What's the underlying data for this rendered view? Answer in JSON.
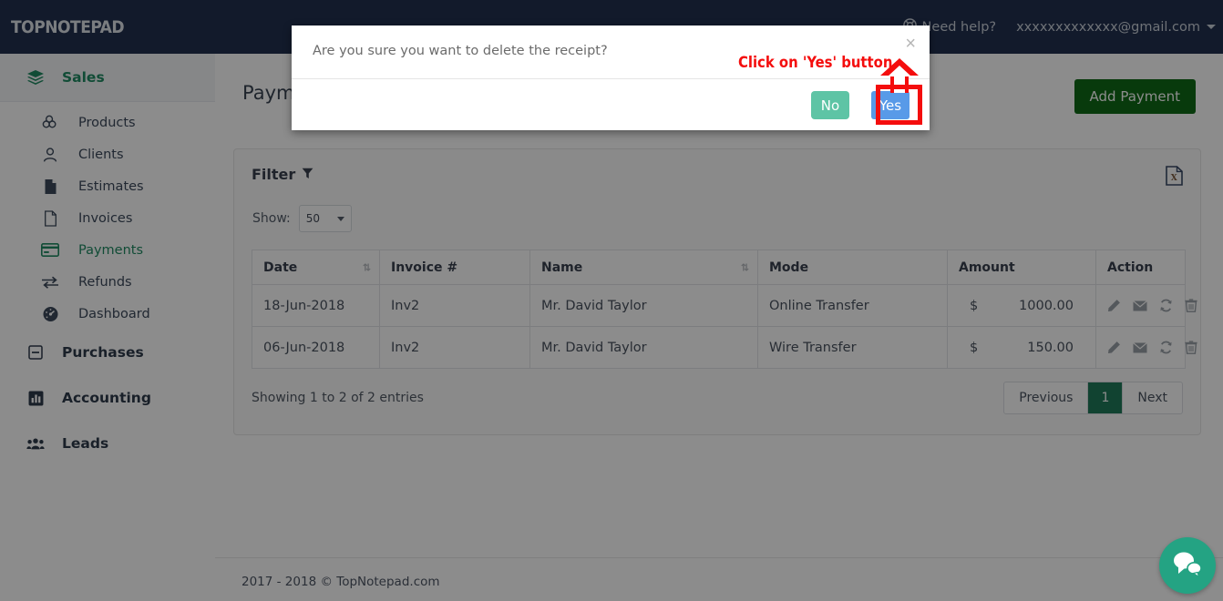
{
  "header": {
    "logo": "TopNotepad",
    "need_help": "Need help?",
    "user_email": "xxxxxxxxxxxxx@gmail.com",
    "bg_color": "#22304f"
  },
  "sidebar": {
    "sections": [
      {
        "label": "Sales",
        "icon": "layers-icon",
        "active": true,
        "items": [
          {
            "label": "Products",
            "icon": "cubes-icon",
            "active": false
          },
          {
            "label": "Clients",
            "icon": "user-icon",
            "active": false
          },
          {
            "label": "Estimates",
            "icon": "file-filled-icon",
            "active": false
          },
          {
            "label": "Invoices",
            "icon": "file-outline-icon",
            "active": false
          },
          {
            "label": "Payments",
            "icon": "credit-card-icon",
            "active": true
          },
          {
            "label": "Refunds",
            "icon": "exchange-arrows-icon",
            "active": false
          },
          {
            "label": "Dashboard",
            "icon": "tachometer-icon",
            "active": false
          }
        ]
      },
      {
        "label": "Purchases",
        "icon": "minus-square-icon",
        "active": false,
        "items": []
      },
      {
        "label": "Accounting",
        "icon": "bar-chart-icon",
        "active": false,
        "items": []
      },
      {
        "label": "Leads",
        "icon": "users-group-icon",
        "active": false,
        "items": []
      }
    ],
    "active_color": "#1f8a63"
  },
  "main": {
    "page_title": "Payments",
    "add_button": "Add Payment",
    "add_button_color": "#0f6b17",
    "filter_label": "Filter",
    "export_icon": "excel-export-icon",
    "show_label": "Show:",
    "show_value": "50",
    "table": {
      "columns": [
        {
          "label": "Date",
          "sortable": true
        },
        {
          "label": "Invoice #",
          "sortable": false
        },
        {
          "label": "Name",
          "sortable": true
        },
        {
          "label": "Mode",
          "sortable": false
        },
        {
          "label": "Amount",
          "sortable": false
        },
        {
          "label": "Action",
          "sortable": false
        }
      ],
      "rows": [
        {
          "date": "18-Jun-2018",
          "invoice": "Inv2",
          "name": "Mr. David Taylor",
          "mode": "Online Transfer",
          "currency": "$",
          "amount": "1000.00",
          "actions": [
            "edit-icon",
            "email-icon",
            "refresh-icon",
            "delete-icon"
          ]
        },
        {
          "date": "06-Jun-2018",
          "invoice": "Inv2",
          "name": "Mr. David Taylor",
          "mode": "Wire Transfer",
          "currency": "$",
          "amount": "150.00",
          "actions": [
            "edit-icon",
            "email-icon",
            "refresh-icon",
            "delete-icon"
          ]
        }
      ]
    },
    "entries_info": "Showing 1 to 2 of 2 entries",
    "pagination": {
      "previous": "Previous",
      "pages": [
        "1"
      ],
      "next": "Next",
      "active_page": "1",
      "active_color": "#1f7a5a"
    }
  },
  "footer": {
    "text": "2017 - 2018 © TopNotepad.com"
  },
  "modal": {
    "message": "Are you sure you want to delete the receipt?",
    "close": "×",
    "no_label": "No",
    "yes_label": "Yes",
    "no_color": "#5ec4a5",
    "yes_color": "#589ae8"
  },
  "annotation": {
    "text": "Click on 'Yes' button",
    "color": "#f40d0d"
  },
  "chat": {
    "icon": "chat-bubbles-icon",
    "color": "#24a383"
  }
}
